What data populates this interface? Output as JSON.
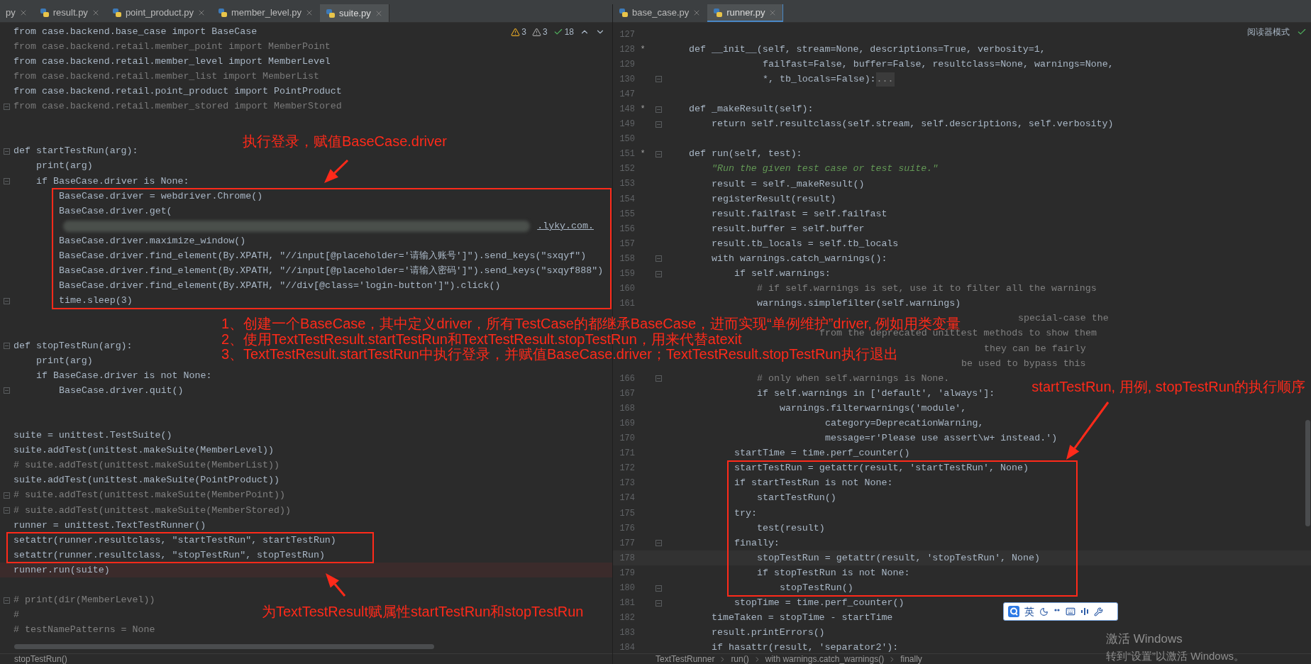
{
  "left_pane": {
    "tabs": [
      {
        "label": "py",
        "kind": "cut",
        "selected": false
      },
      {
        "label": "result.py",
        "kind": "file",
        "selected": false
      },
      {
        "label": "point_product.py",
        "kind": "file",
        "selected": false
      },
      {
        "label": "member_level.py",
        "kind": "file",
        "selected": false
      },
      {
        "label": "suite.py",
        "kind": "file",
        "selected": true
      }
    ],
    "inspections": [
      {
        "kind": "warning",
        "count": "3"
      },
      {
        "kind": "weak-warning",
        "count": "3"
      },
      {
        "kind": "ok",
        "count": "18"
      }
    ],
    "blocks": [
      {
        "kind": "plain",
        "lines": [
          {
            "kind": "code",
            "text": "from case.backend.base_case import BaseCase"
          },
          {
            "kind": "dim",
            "text": "from case.backend.retail.member_point import MemberPoint"
          },
          {
            "kind": "code",
            "text": "from case.backend.retail.member_level import MemberLevel"
          },
          {
            "kind": "dim",
            "text": "from case.backend.retail.member_list import MemberList"
          },
          {
            "kind": "code",
            "text": "from case.backend.retail.point_product import PointProduct"
          },
          {
            "kind": "dim",
            "text": "from case.backend.retail.member_stored import MemberStored",
            "fold": true
          },
          {
            "kind": "blank"
          },
          {
            "kind": "blank"
          },
          {
            "kind": "code",
            "text": "def startTestRun(arg):",
            "fold": true
          },
          {
            "kind": "code",
            "text": "    print(arg)"
          },
          {
            "kind": "code",
            "text": "    if BaseCase.driver is None:",
            "fold": true
          }
        ]
      },
      {
        "kind": "boxed",
        "lines": [
          {
            "kind": "code",
            "text": "        BaseCase.driver = webdriver.Chrome()"
          },
          {
            "kind": "code",
            "text": "        BaseCase.driver.get("
          },
          {
            "kind": "redacted",
            "text": ".lyky.com."
          },
          {
            "kind": "code",
            "text": "        BaseCase.driver.maximize_window()"
          },
          {
            "kind": "code",
            "text": "        BaseCase.driver.find_element(By.XPATH, \"//input[@placeholder='请输入账号']\").send_keys(\"sxqyf\")"
          },
          {
            "kind": "code",
            "text": "        BaseCase.driver.find_element(By.XPATH, \"//input[@placeholder='请输入密码']\").send_keys(\"sxqyf888\")"
          },
          {
            "kind": "code",
            "text": "        BaseCase.driver.find_element(By.XPATH, \"//div[@class='login-button']\").click()"
          },
          {
            "kind": "code",
            "text": "        time.sleep(3)",
            "fold": true
          }
        ]
      },
      {
        "kind": "plain",
        "lines": [
          {
            "kind": "blank"
          },
          {
            "kind": "blank"
          },
          {
            "kind": "code",
            "text": "def stopTestRun(arg):",
            "fold": true
          },
          {
            "kind": "code",
            "text": "    print(arg)"
          },
          {
            "kind": "code",
            "text": "    if BaseCase.driver is not None:"
          },
          {
            "kind": "code",
            "text": "        BaseCase.driver.quit()",
            "fold": true
          },
          {
            "kind": "blank"
          },
          {
            "kind": "blank"
          },
          {
            "kind": "code",
            "text": "suite = unittest.TestSuite()"
          },
          {
            "kind": "code",
            "text": "suite.addTest(unittest.makeSuite(MemberLevel))"
          },
          {
            "kind": "comment",
            "text": "# suite.addTest(unittest.makeSuite(MemberList))"
          },
          {
            "kind": "code",
            "text": "suite.addTest(unittest.makeSuite(PointProduct))"
          },
          {
            "kind": "comment",
            "text": "# suite.addTest(unittest.makeSuite(MemberPoint))",
            "fold": true
          },
          {
            "kind": "comment",
            "text": "# suite.addTest(unittest.makeSuite(MemberStored))",
            "fold": true
          },
          {
            "kind": "code",
            "text": "runner = unittest.TextTestRunner()"
          }
        ]
      },
      {
        "kind": "boxed",
        "lines": [
          {
            "kind": "code",
            "text": "setattr(runner.resultclass, \"startTestRun\", startTestRun)"
          },
          {
            "kind": "code",
            "text": "setattr(runner.resultclass, \"stopTestRun\", stopTestRun)"
          }
        ]
      },
      {
        "kind": "plain",
        "lines": [
          {
            "kind": "error-line",
            "text": "runner.run(suite)"
          },
          {
            "kind": "blank"
          },
          {
            "kind": "comment",
            "text": "# print(dir(MemberLevel))",
            "fold": true
          },
          {
            "kind": "comment",
            "text": "#"
          },
          {
            "kind": "comment",
            "text": "# testNamePatterns = None"
          }
        ]
      }
    ],
    "breadcrumbs": [
      "stopTestRun()"
    ]
  },
  "right_pane": {
    "tabs": [
      {
        "label": "base_case.py",
        "kind": "file",
        "selected": false
      },
      {
        "label": "runner.py",
        "kind": "file",
        "selected": true
      }
    ],
    "reader_mode": "阅读器模式",
    "blocks": [
      {
        "kind": "plain",
        "lines": [
          {
            "number": "127",
            "kind": "blank"
          },
          {
            "number": "128",
            "kind": "code",
            "marker": "*",
            "text": "    def __init__(self, stream=None, descriptions=True, verbosity=1,"
          },
          {
            "number": "129",
            "kind": "code",
            "text": "                 failfast=False, buffer=False, resultclass=None, warnings=None,"
          },
          {
            "number": "130",
            "kind": "code",
            "fold": true,
            "text": "                 *, tb_locals=False):",
            "folded": "..."
          },
          {
            "number": "147",
            "kind": "blank"
          },
          {
            "number": "148",
            "kind": "code",
            "marker": "*",
            "fold": true,
            "text": "    def _makeResult(self):"
          },
          {
            "number": "149",
            "kind": "code",
            "fold": true,
            "text": "        return self.resultclass(self.stream, self.descriptions, self.verbosity)"
          },
          {
            "number": "150",
            "kind": "blank"
          },
          {
            "number": "151",
            "kind": "code",
            "marker": "*",
            "fold": true,
            "text": "    def run(self, test):"
          },
          {
            "number": "152",
            "kind": "docstring",
            "text": "        \"Run the given test case or test suite.\""
          },
          {
            "number": "153",
            "kind": "code",
            "text": "        result = self._makeResult()"
          },
          {
            "number": "154",
            "kind": "code",
            "text": "        registerResult(result)"
          },
          {
            "number": "155",
            "kind": "code",
            "text": "        result.failfast = self.failfast"
          },
          {
            "number": "156",
            "kind": "code",
            "text": "        result.buffer = self.buffer"
          },
          {
            "number": "157",
            "kind": "code",
            "text": "        result.tb_locals = self.tb_locals"
          },
          {
            "number": "158",
            "kind": "code",
            "fold": true,
            "text": "        with warnings.catch_warnings():"
          },
          {
            "number": "159",
            "kind": "code",
            "fold": true,
            "text": "            if self.warnings:"
          },
          {
            "number": "160",
            "kind": "comment",
            "text": "                # if self.warnings is set, use it to filter all the warnings"
          },
          {
            "number": "161",
            "kind": "code",
            "text": "                warnings.simplefilter(self.warnings)"
          },
          {
            "kind": "comment",
            "text": "                                                              special-case the"
          },
          {
            "kind": "comment",
            "text": "                           from the deprecated unittest methods to show them"
          },
          {
            "kind": "comment",
            "text": "                                                        they can be fairly"
          },
          {
            "kind": "comment",
            "text": "                                                    be used to bypass this"
          },
          {
            "number": "166",
            "kind": "comment",
            "fold": true,
            "text": "                # only when self.warnings is None."
          },
          {
            "number": "167",
            "kind": "code",
            "text": "                if self.warnings in ['default', 'always']:"
          },
          {
            "number": "168",
            "kind": "code",
            "text": "                    warnings.filterwarnings('module',"
          },
          {
            "number": "169",
            "kind": "code",
            "text": "                            category=DeprecationWarning,"
          },
          {
            "number": "170",
            "kind": "code",
            "text": "                            message=r'Please use assert\\w+ instead.')"
          },
          {
            "number": "171",
            "kind": "code",
            "text": "            startTime = time.perf_counter()"
          }
        ]
      },
      {
        "kind": "boxed",
        "lines": [
          {
            "number": "172",
            "kind": "code",
            "text": "            startTestRun = getattr(result, 'startTestRun', None)"
          },
          {
            "number": "173",
            "kind": "code",
            "text": "            if startTestRun is not None:"
          },
          {
            "number": "174",
            "kind": "code",
            "text": "                startTestRun()"
          },
          {
            "number": "175",
            "kind": "code",
            "text": "            try:"
          },
          {
            "number": "176",
            "kind": "code",
            "text": "                test(result)"
          },
          {
            "number": "177",
            "kind": "code",
            "fold": true,
            "text": "            finally:"
          },
          {
            "number": "178",
            "kind": "caret-line",
            "text": "                stopTestRun = getattr(result, 'stopTestRun', None)"
          },
          {
            "number": "179",
            "kind": "code",
            "text": "                if stopTestRun is not None:"
          },
          {
            "number": "180",
            "kind": "code",
            "fold": true,
            "text": "                    stopTestRun()"
          }
        ]
      },
      {
        "kind": "plain",
        "lines": [
          {
            "number": "181",
            "kind": "code",
            "fold": true,
            "text": "            stopTime = time.perf_counter()"
          },
          {
            "number": "182",
            "kind": "code",
            "text": "        timeTaken = stopTime - startTime"
          },
          {
            "number": "183",
            "kind": "code",
            "text": "        result.printErrors()"
          },
          {
            "number": "184",
            "kind": "code",
            "text": "        if hasattr(result, 'separator2'):"
          }
        ]
      }
    ],
    "breadcrumbs": [
      "TextTestRunner",
      "run()",
      "with warnings.catch_warnings()",
      "finally"
    ]
  },
  "annotations": [
    {
      "kind": "login",
      "text": "执行登录，赋值BaseCase.driver"
    },
    {
      "kind": "note-1",
      "text": "1、创建一个BaseCase，其中定义driver，所有TestCase的都继承BaseCase，进而实现“单例维护”driver, 例如用类变量"
    },
    {
      "kind": "note-2",
      "text": "2、使用TextTestResult.startTestRun和TextTestResult.stopTestRun，用来代替atexit"
    },
    {
      "kind": "note-3",
      "text": "3、TextTestResult.startTestRun中执行登录，并赋值BaseCase.driver；TextTestResult.stopTestRun执行退出"
    },
    {
      "kind": "order",
      "text": "startTestRun, 用例, stopTestRun的执行顺序"
    },
    {
      "kind": "setattr",
      "text": "为TextTestResult赋属性startTestRun和stopTestRun"
    }
  ],
  "ime_bar": {
    "mode": "英"
  },
  "activation": {
    "title": "激活 Windows",
    "hint": "转到“设置”以激活 Windows。"
  }
}
